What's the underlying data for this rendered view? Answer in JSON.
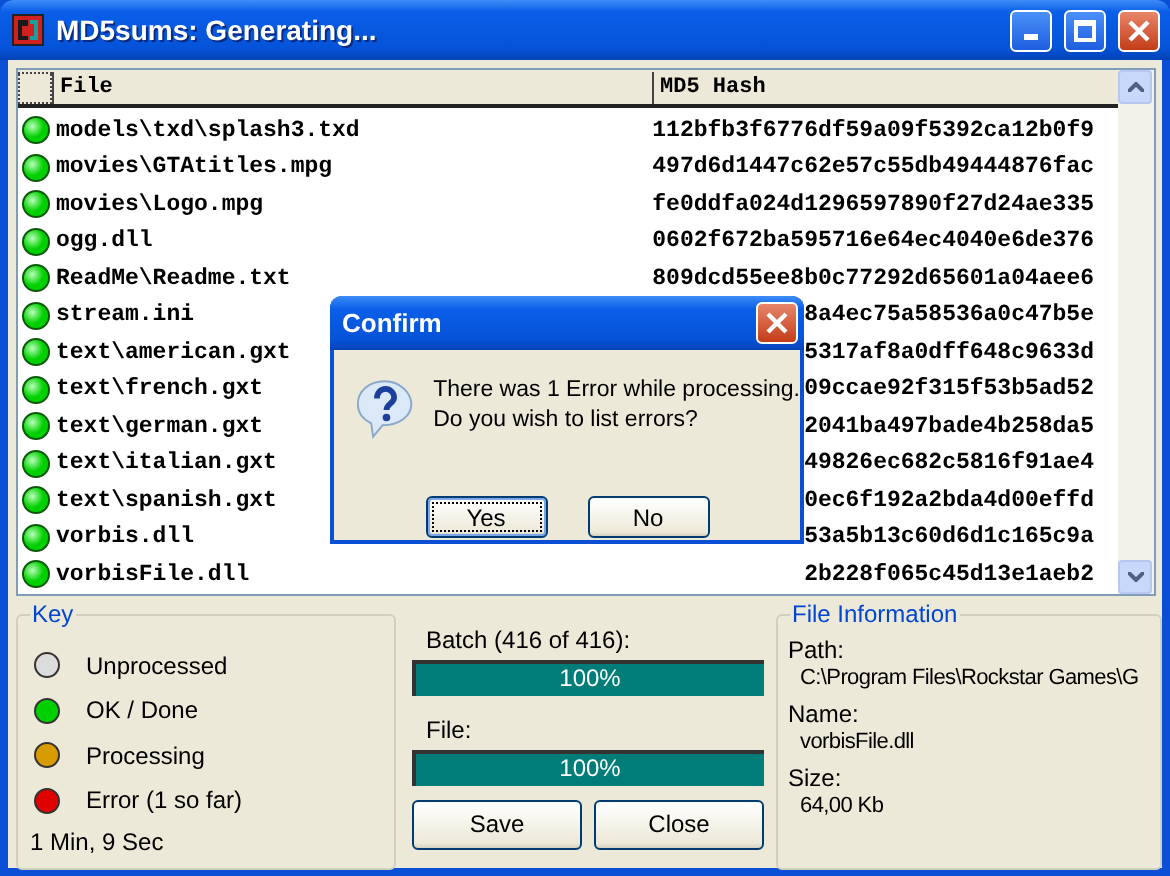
{
  "window": {
    "title": "MD5sums: Generating..."
  },
  "list": {
    "columns": [
      "File",
      "MD5 Hash"
    ],
    "rows": [
      {
        "file": "models\\txd\\splash3.txd",
        "hash": "112bfb3f6776df59a09f5392ca12b0f9"
      },
      {
        "file": "movies\\GTAtitles.mpg",
        "hash": "497d6d1447c62e57c55db49444876fac"
      },
      {
        "file": "movies\\Logo.mpg",
        "hash": "fe0ddfa024d1296597890f27d24ae335"
      },
      {
        "file": "ogg.dll",
        "hash": "0602f672ba595716e64ec4040e6de376"
      },
      {
        "file": "ReadMe\\Readme.txt",
        "hash": "809dcd55ee8b0c77292d65601a04aee6"
      },
      {
        "file": "stream.ini",
        "hash": "8a4ec75a58536a0c47b5e"
      },
      {
        "file": "text\\american.gxt",
        "hash": "5317af8a0dff648c9633d"
      },
      {
        "file": "text\\french.gxt",
        "hash": "09ccae92f315f53b5ad52"
      },
      {
        "file": "text\\german.gxt",
        "hash": "2041ba497bade4b258da5"
      },
      {
        "file": "text\\italian.gxt",
        "hash": "49826ec682c5816f91ae4"
      },
      {
        "file": "text\\spanish.gxt",
        "hash": "0ec6f192a2bda4d00effd"
      },
      {
        "file": "vorbis.dll",
        "hash": "53a5b13c60d6d1c165c9a"
      },
      {
        "file": "vorbisFile.dll",
        "hash": "2b228f065c45d13e1aeb2"
      }
    ]
  },
  "key": {
    "title": "Key",
    "items": [
      {
        "label": "Unprocessed",
        "color": "#dcdcdc"
      },
      {
        "label": "OK / Done",
        "color": "#00d000"
      },
      {
        "label": "Processing",
        "color": "#d89c00"
      },
      {
        "label": "Error  (1 so far)",
        "color": "#e00000"
      }
    ],
    "elapsed": "1 Min, 9 Sec"
  },
  "progress": {
    "batch_label": "Batch (416 of 416):",
    "batch": {
      "level": 1,
      "reading": "100%"
    },
    "file_label": "File:",
    "file": {
      "level": 1,
      "reading": "100%"
    },
    "buttons": [
      "Save",
      "Close"
    ]
  },
  "file_info": {
    "title": "File Information",
    "fields": [
      {
        "label": "Path:",
        "value": "C:\\Program Files\\Rockstar Games\\G"
      },
      {
        "label": "Name:",
        "value": "vorbisFile.dll"
      },
      {
        "label": "Size:",
        "value": "64,00 Kb"
      }
    ]
  },
  "dialog": {
    "title": "Confirm",
    "message": [
      "There was 1 Error while processing.",
      "Do you wish to list errors?"
    ],
    "buttons": [
      {
        "label": "Yes",
        "selected": true
      },
      {
        "label": "No",
        "selected": false
      }
    ]
  }
}
